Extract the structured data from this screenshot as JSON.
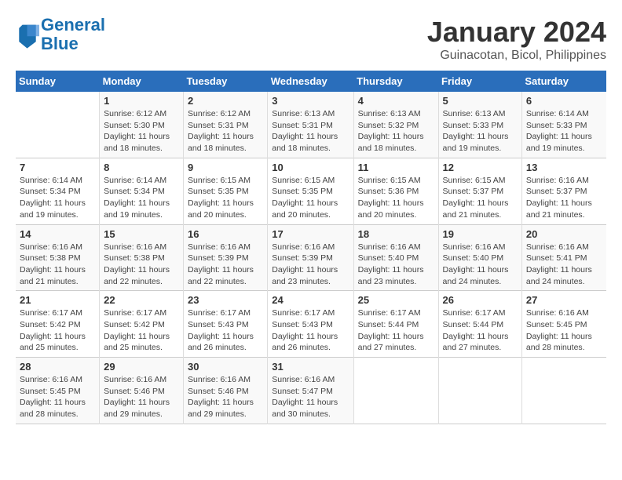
{
  "logo": {
    "text_general": "General",
    "text_blue": "Blue"
  },
  "title": "January 2024",
  "subtitle": "Guinacotan, Bicol, Philippines",
  "weekdays": [
    "Sunday",
    "Monday",
    "Tuesday",
    "Wednesday",
    "Thursday",
    "Friday",
    "Saturday"
  ],
  "weeks": [
    [
      {
        "day": "",
        "info": ""
      },
      {
        "day": "1",
        "info": "Sunrise: 6:12 AM\nSunset: 5:30 PM\nDaylight: 11 hours\nand 18 minutes."
      },
      {
        "day": "2",
        "info": "Sunrise: 6:12 AM\nSunset: 5:31 PM\nDaylight: 11 hours\nand 18 minutes."
      },
      {
        "day": "3",
        "info": "Sunrise: 6:13 AM\nSunset: 5:31 PM\nDaylight: 11 hours\nand 18 minutes."
      },
      {
        "day": "4",
        "info": "Sunrise: 6:13 AM\nSunset: 5:32 PM\nDaylight: 11 hours\nand 18 minutes."
      },
      {
        "day": "5",
        "info": "Sunrise: 6:13 AM\nSunset: 5:33 PM\nDaylight: 11 hours\nand 19 minutes."
      },
      {
        "day": "6",
        "info": "Sunrise: 6:14 AM\nSunset: 5:33 PM\nDaylight: 11 hours\nand 19 minutes."
      }
    ],
    [
      {
        "day": "7",
        "info": "Sunrise: 6:14 AM\nSunset: 5:34 PM\nDaylight: 11 hours\nand 19 minutes."
      },
      {
        "day": "8",
        "info": "Sunrise: 6:14 AM\nSunset: 5:34 PM\nDaylight: 11 hours\nand 19 minutes."
      },
      {
        "day": "9",
        "info": "Sunrise: 6:15 AM\nSunset: 5:35 PM\nDaylight: 11 hours\nand 20 minutes."
      },
      {
        "day": "10",
        "info": "Sunrise: 6:15 AM\nSunset: 5:35 PM\nDaylight: 11 hours\nand 20 minutes."
      },
      {
        "day": "11",
        "info": "Sunrise: 6:15 AM\nSunset: 5:36 PM\nDaylight: 11 hours\nand 20 minutes."
      },
      {
        "day": "12",
        "info": "Sunrise: 6:15 AM\nSunset: 5:37 PM\nDaylight: 11 hours\nand 21 minutes."
      },
      {
        "day": "13",
        "info": "Sunrise: 6:16 AM\nSunset: 5:37 PM\nDaylight: 11 hours\nand 21 minutes."
      }
    ],
    [
      {
        "day": "14",
        "info": "Sunrise: 6:16 AM\nSunset: 5:38 PM\nDaylight: 11 hours\nand 21 minutes."
      },
      {
        "day": "15",
        "info": "Sunrise: 6:16 AM\nSunset: 5:38 PM\nDaylight: 11 hours\nand 22 minutes."
      },
      {
        "day": "16",
        "info": "Sunrise: 6:16 AM\nSunset: 5:39 PM\nDaylight: 11 hours\nand 22 minutes."
      },
      {
        "day": "17",
        "info": "Sunrise: 6:16 AM\nSunset: 5:39 PM\nDaylight: 11 hours\nand 23 minutes."
      },
      {
        "day": "18",
        "info": "Sunrise: 6:16 AM\nSunset: 5:40 PM\nDaylight: 11 hours\nand 23 minutes."
      },
      {
        "day": "19",
        "info": "Sunrise: 6:16 AM\nSunset: 5:40 PM\nDaylight: 11 hours\nand 24 minutes."
      },
      {
        "day": "20",
        "info": "Sunrise: 6:16 AM\nSunset: 5:41 PM\nDaylight: 11 hours\nand 24 minutes."
      }
    ],
    [
      {
        "day": "21",
        "info": "Sunrise: 6:17 AM\nSunset: 5:42 PM\nDaylight: 11 hours\nand 25 minutes."
      },
      {
        "day": "22",
        "info": "Sunrise: 6:17 AM\nSunset: 5:42 PM\nDaylight: 11 hours\nand 25 minutes."
      },
      {
        "day": "23",
        "info": "Sunrise: 6:17 AM\nSunset: 5:43 PM\nDaylight: 11 hours\nand 26 minutes."
      },
      {
        "day": "24",
        "info": "Sunrise: 6:17 AM\nSunset: 5:43 PM\nDaylight: 11 hours\nand 26 minutes."
      },
      {
        "day": "25",
        "info": "Sunrise: 6:17 AM\nSunset: 5:44 PM\nDaylight: 11 hours\nand 27 minutes."
      },
      {
        "day": "26",
        "info": "Sunrise: 6:17 AM\nSunset: 5:44 PM\nDaylight: 11 hours\nand 27 minutes."
      },
      {
        "day": "27",
        "info": "Sunrise: 6:16 AM\nSunset: 5:45 PM\nDaylight: 11 hours\nand 28 minutes."
      }
    ],
    [
      {
        "day": "28",
        "info": "Sunrise: 6:16 AM\nSunset: 5:45 PM\nDaylight: 11 hours\nand 28 minutes."
      },
      {
        "day": "29",
        "info": "Sunrise: 6:16 AM\nSunset: 5:46 PM\nDaylight: 11 hours\nand 29 minutes."
      },
      {
        "day": "30",
        "info": "Sunrise: 6:16 AM\nSunset: 5:46 PM\nDaylight: 11 hours\nand 29 minutes."
      },
      {
        "day": "31",
        "info": "Sunrise: 6:16 AM\nSunset: 5:47 PM\nDaylight: 11 hours\nand 30 minutes."
      },
      {
        "day": "",
        "info": ""
      },
      {
        "day": "",
        "info": ""
      },
      {
        "day": "",
        "info": ""
      }
    ]
  ]
}
